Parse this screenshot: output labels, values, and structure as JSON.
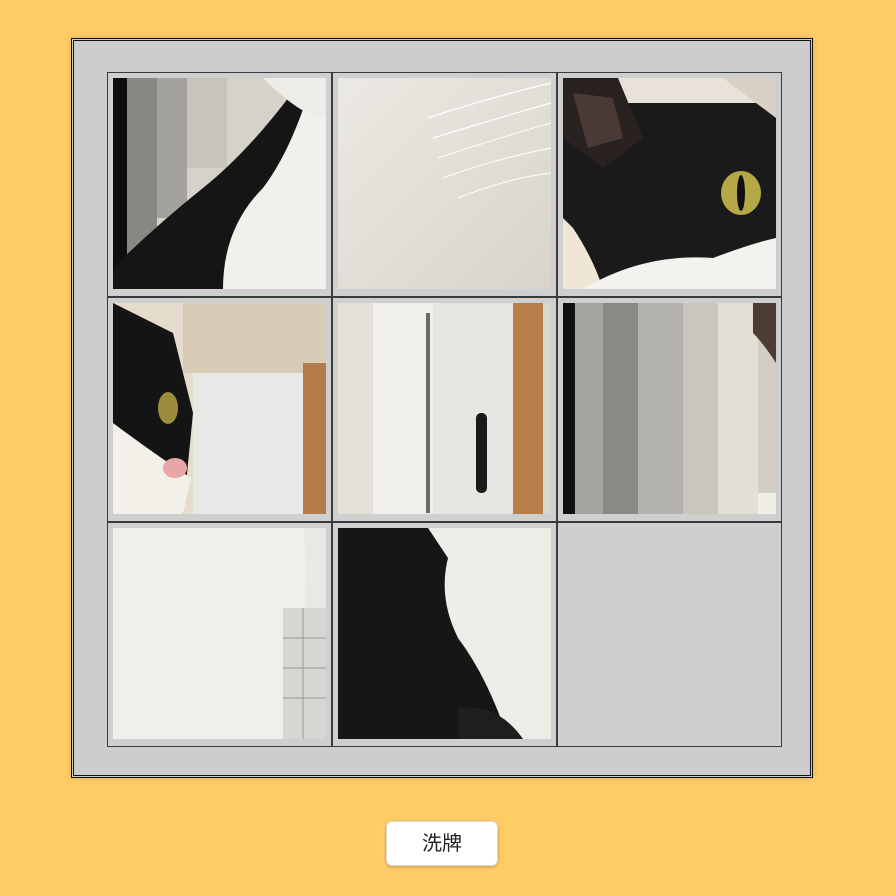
{
  "puzzle": {
    "rows": 3,
    "cols": 3,
    "tiles": [
      {
        "slot": 1,
        "content": "cat-back-and-curtains"
      },
      {
        "slot": 2,
        "content": "white-fur-whiskers"
      },
      {
        "slot": 3,
        "content": "cat-face-yellow-eye"
      },
      {
        "slot": 4,
        "content": "cat-nose-and-box"
      },
      {
        "slot": 5,
        "content": "white-box-handle"
      },
      {
        "slot": 6,
        "content": "hanging-clothes"
      },
      {
        "slot": 7,
        "content": "white-fur-tiles"
      },
      {
        "slot": 8,
        "content": "black-white-fur"
      },
      {
        "slot": 9,
        "content": "empty"
      }
    ]
  },
  "controls": {
    "shuffle_label": "洗牌"
  },
  "colors": {
    "background": "#ffcc66",
    "board": "#cdcdcd"
  }
}
